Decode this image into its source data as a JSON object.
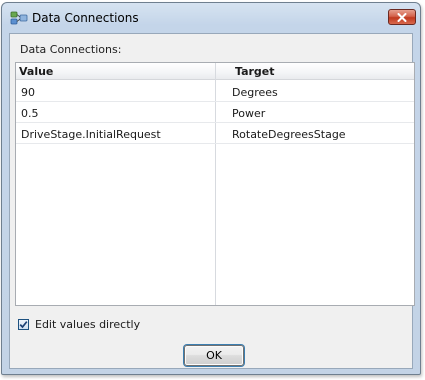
{
  "window": {
    "title": "Data Connections",
    "close_icon": "close-icon"
  },
  "section_label": "Data Connections:",
  "grid": {
    "columns": [
      "Value",
      "Target"
    ],
    "rows": [
      {
        "value": "90",
        "target": "Degrees"
      },
      {
        "value": "0.5",
        "target": "Power"
      },
      {
        "value": "DriveStage.InitialRequest",
        "target": "RotateDegreesStage"
      }
    ]
  },
  "edit_directly": {
    "label": "Edit values directly",
    "checked": true
  },
  "buttons": {
    "ok_label": "OK"
  },
  "colors": {
    "titlebar": "#c4d5e9",
    "close_button": "#c0391f",
    "client_bg": "#f0f0f0",
    "ok_focus": "#3c7fb1"
  }
}
